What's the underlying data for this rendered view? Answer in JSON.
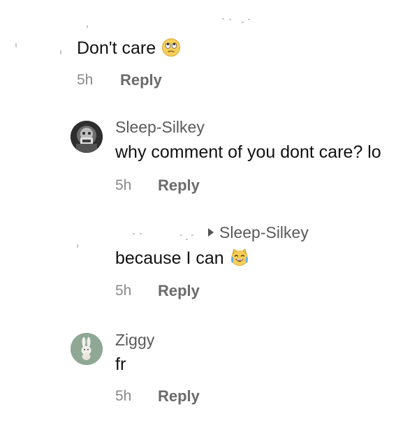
{
  "comments": [
    {
      "text": "Don't care",
      "emoji": "face-with-rolling-eyes",
      "time": "5h",
      "reply_label": "Reply"
    },
    {
      "username": "Sleep-Silkey",
      "text": "why comment of you dont care? lo",
      "time": "5h",
      "reply_label": "Reply"
    },
    {
      "reply_to": "Sleep-Silkey",
      "text": "because I can",
      "emoji": "grinning-cat-with-tears-of-joy",
      "time": "5h",
      "reply_label": "Reply"
    },
    {
      "username": "Ziggy",
      "text": "fr",
      "time": "5h",
      "reply_label": "Reply"
    }
  ],
  "colors": {
    "text": "#111111",
    "username": "#5a5a5a",
    "meta": "#8a8a8a",
    "reply": "#6b6b6b",
    "ziggy_avatar_bg": "#8fa896"
  }
}
